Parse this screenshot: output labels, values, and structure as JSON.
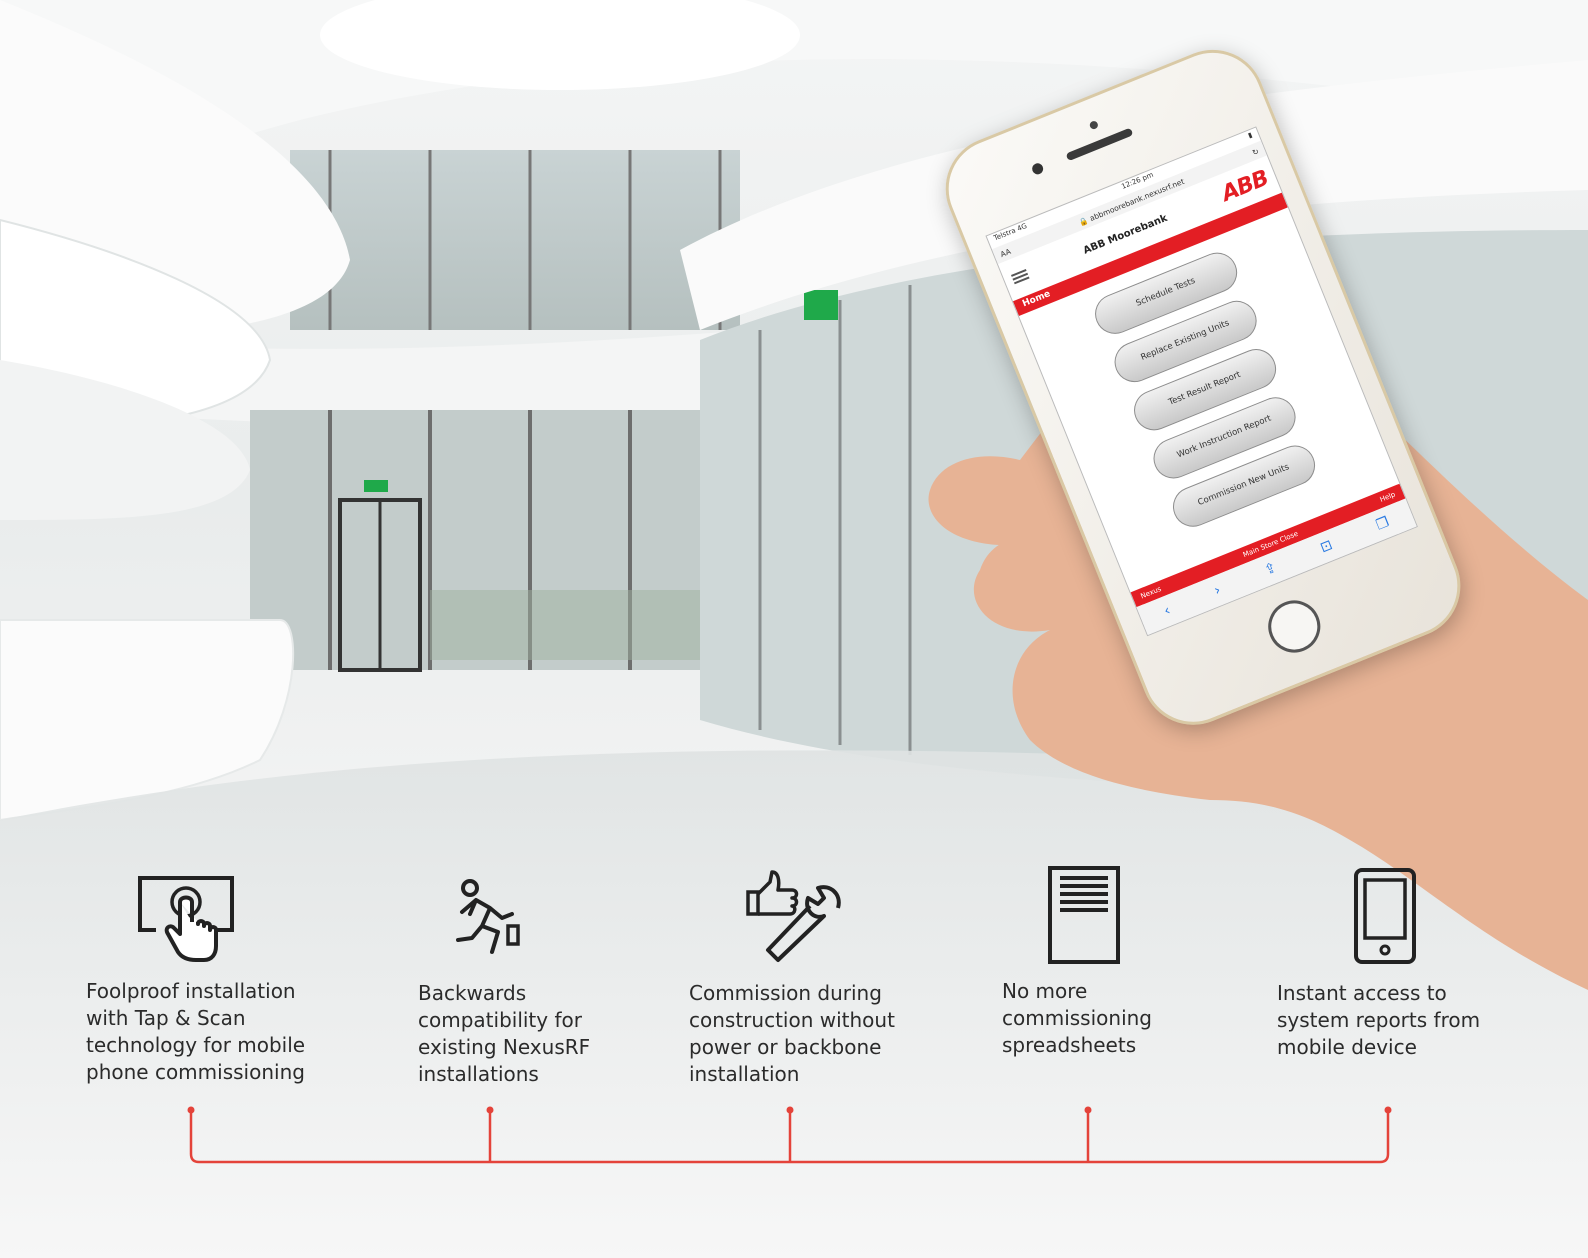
{
  "phone": {
    "status_carrier": "Telstra 4G",
    "status_time": "12:26 pm",
    "url": "abbmoorebank.nexusrf.net",
    "url_size_label": "AA",
    "app_title": "ABB Moorebank",
    "logo": "ABB",
    "section": "Home",
    "buttons": [
      "Schedule Tests",
      "Replace Existing Units",
      "Test Result Report",
      "Work Instruction Report",
      "Commission New Units"
    ],
    "footer_left": "Nexus",
    "footer_mid": "Main Store Close",
    "footer_right": "Help",
    "icons": [
      "back-icon",
      "forward-icon",
      "share-icon",
      "bookmarks-icon",
      "tabs-icon"
    ]
  },
  "features": [
    {
      "icon": "touch-screen-icon",
      "caption": "Foolproof installation\nwith Tap & Scan\ntechnology for mobile\nphone commissioning"
    },
    {
      "icon": "running-man-icon",
      "caption": "Backwards\ncompatibility for\nexisting NexusRF\ninstallations"
    },
    {
      "icon": "thumbs-up-wrench-icon",
      "caption": "Commission during\nconstruction without\npower or backbone\ninstallation"
    },
    {
      "icon": "document-list-icon",
      "caption": "No more\ncommissioning\nspreadsheets"
    },
    {
      "icon": "mobile-device-icon",
      "caption": "Instant access to\nsystem reports from\nmobile device"
    }
  ],
  "colors": {
    "accent": "#e4433a",
    "text": "#2b2b2b",
    "exit_sign": "#1fa94a"
  }
}
